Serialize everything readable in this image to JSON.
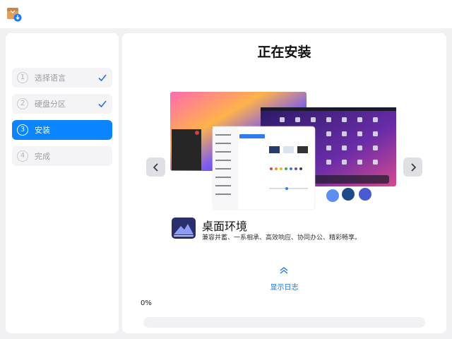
{
  "colors": {
    "accent": "#0a84ff",
    "link": "#1a73e8",
    "background": "#f1f1f3"
  },
  "icons": {
    "app": "installer-package-icon",
    "check": "checkmark-icon",
    "prev": "chevron-left-icon",
    "next": "chevron-right-icon",
    "log": "double-chevron-up-icon",
    "feature": "desktop-mountain-icon"
  },
  "steps": [
    {
      "num": "1",
      "label": "选择语言",
      "done": true
    },
    {
      "num": "2",
      "label": "硬盘分区",
      "done": true
    },
    {
      "num": "3",
      "label": "安装",
      "active": true
    },
    {
      "num": "4",
      "label": "完成"
    }
  ],
  "main": {
    "title": "正在安装",
    "feature": {
      "title": "桌面环境",
      "description": "兼容并蓄、一系相承、高效响应、协同办公、精彩畅享。"
    },
    "show_log": "显示日志",
    "progress": {
      "percent": 0,
      "label": "0%"
    }
  }
}
